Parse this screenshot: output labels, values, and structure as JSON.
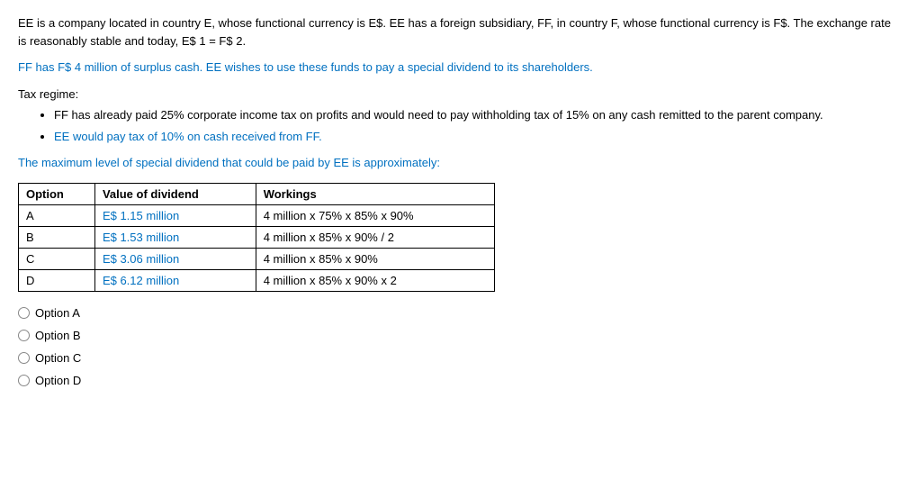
{
  "paragraphs": {
    "intro": "EE is a company located in country E, whose functional currency is E$. EE has a foreign subsidiary, FF, in country F, whose functional currency is F$. The exchange rate is reasonably stable and today, E$ 1 = F$ 2.",
    "surplus": "FF has F$ 4 million of surplus cash. EE wishes to use these funds to pay a special dividend to its shareholders.",
    "tax_regime_label": "Tax regime:",
    "bullet1": "FF has already paid 25% corporate income tax on profits and would need to pay withholding tax of 15% on any cash remitted to the parent company.",
    "bullet2": "EE would pay tax of 10% on cash received from FF.",
    "question": "The maximum level of special dividend that could be paid by EE is approximately:"
  },
  "table": {
    "headers": [
      "Option",
      "Value of dividend",
      "Workings"
    ],
    "rows": [
      {
        "option": "A",
        "value": "E$ 1.15 million",
        "workings": "4 million x 75% x 85% x 90%"
      },
      {
        "option": "B",
        "value": "E$ 1.53 million",
        "workings": "4 million x 85% x 90% / 2"
      },
      {
        "option": "C",
        "value": "E$ 3.06 million",
        "workings": "4 million x 85% x 90%"
      },
      {
        "option": "D",
        "value": "E$ 6.12 million",
        "workings": "4 million x 85% x 90% x 2"
      }
    ]
  },
  "radio_options": [
    {
      "id": "optA",
      "label": "Option A"
    },
    {
      "id": "optB",
      "label": "Option B"
    },
    {
      "id": "optC",
      "label": "Option C"
    },
    {
      "id": "optD",
      "label": "Option D"
    }
  ]
}
